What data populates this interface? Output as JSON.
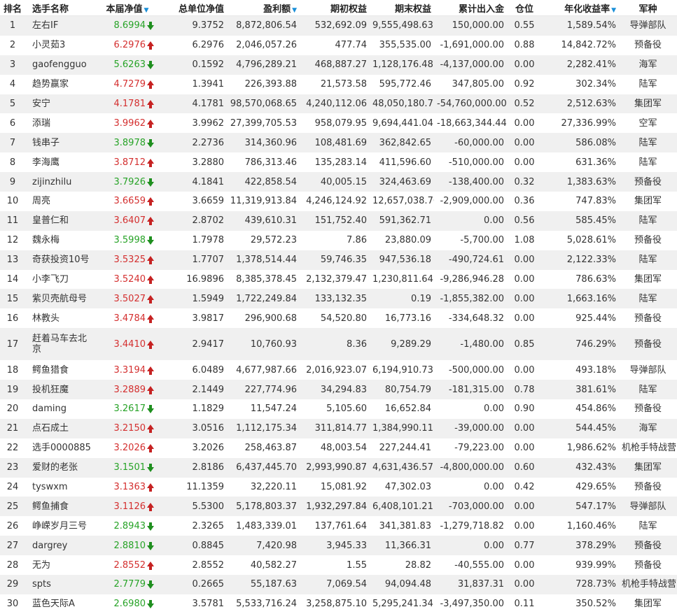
{
  "headers": {
    "rank": "排名",
    "name": "选手名称",
    "nav": "本届净值",
    "total_nav": "总单位净值",
    "profit": "盈利额",
    "start_equity": "期初权益",
    "end_equity": "期末权益",
    "cum_flow": "累计出入金",
    "position": "仓位",
    "annual_return": "年化收益率",
    "army": "军种"
  },
  "sort_icon": "triangle-down-icon",
  "colors": {
    "up": "#d42f2f",
    "down": "#27a327",
    "sort": "#1a8fd8",
    "row_alt": "#f0f0f0"
  },
  "rows": [
    {
      "rank": "1",
      "name": "左右IF",
      "nav": "8.6994",
      "dir": "down",
      "total_nav": "9.3752",
      "profit": "8,872,806.54",
      "start_equity": "532,692.09",
      "end_equity": "9,555,498.63",
      "cum_flow": "150,000.00",
      "position": "0.55",
      "annual_return": "1,589.54%",
      "army": "导弹部队"
    },
    {
      "rank": "2",
      "name": "小灵茹3",
      "nav": "6.2976",
      "dir": "up",
      "total_nav": "6.2976",
      "profit": "2,046,057.26",
      "start_equity": "477.74",
      "end_equity": "355,535.00",
      "cum_flow": "-1,691,000.00",
      "position": "0.88",
      "annual_return": "14,842.72%",
      "army": "预备役"
    },
    {
      "rank": "3",
      "name": "gaofengguo",
      "nav": "5.6263",
      "dir": "down",
      "total_nav": "0.1592",
      "profit": "4,796,289.21",
      "start_equity": "468,887.27",
      "end_equity": "1,128,176.48",
      "cum_flow": "-4,137,000.00",
      "position": "0.00",
      "annual_return": "2,282.41%",
      "army": "海军"
    },
    {
      "rank": "4",
      "name": "趋势赢家",
      "nav": "4.7279",
      "dir": "up",
      "total_nav": "1.3941",
      "profit": "226,393.88",
      "start_equity": "21,573.58",
      "end_equity": "595,772.46",
      "cum_flow": "347,805.00",
      "position": "0.92",
      "annual_return": "302.34%",
      "army": "陆军"
    },
    {
      "rank": "5",
      "name": "安宁",
      "nav": "4.1781",
      "dir": "up",
      "total_nav": "4.1781",
      "profit": "98,570,068.65",
      "start_equity": "4,240,112.06",
      "end_equity": "48,050,180.71",
      "cum_flow": "-54,760,000.00",
      "position": "0.52",
      "annual_return": "2,512.63%",
      "army": "集团军"
    },
    {
      "rank": "6",
      "name": "添瑞",
      "nav": "3.9962",
      "dir": "up",
      "total_nav": "3.9962",
      "profit": "27,399,705.53",
      "start_equity": "958,079.95",
      "end_equity": "9,694,441.04",
      "cum_flow": "-18,663,344.44",
      "position": "0.00",
      "annual_return": "27,336.99%",
      "army": "空军"
    },
    {
      "rank": "7",
      "name": "钱串子",
      "nav": "3.8978",
      "dir": "down",
      "total_nav": "2.2736",
      "profit": "314,360.96",
      "start_equity": "108,481.69",
      "end_equity": "362,842.65",
      "cum_flow": "-60,000.00",
      "position": "0.00",
      "annual_return": "586.08%",
      "army": "陆军"
    },
    {
      "rank": "8",
      "name": "李海鹰",
      "nav": "3.8712",
      "dir": "up",
      "total_nav": "3.2880",
      "profit": "786,313.46",
      "start_equity": "135,283.14",
      "end_equity": "411,596.60",
      "cum_flow": "-510,000.00",
      "position": "0.00",
      "annual_return": "631.36%",
      "army": "陆军"
    },
    {
      "rank": "9",
      "name": "zijinzhilu",
      "nav": "3.7926",
      "dir": "down",
      "total_nav": "4.1841",
      "profit": "422,858.54",
      "start_equity": "40,005.15",
      "end_equity": "324,463.69",
      "cum_flow": "-138,400.00",
      "position": "0.32",
      "annual_return": "1,383.63%",
      "army": "预备役"
    },
    {
      "rank": "10",
      "name": "周亮",
      "nav": "3.6659",
      "dir": "up",
      "total_nav": "3.6659",
      "profit": "11,319,913.84",
      "start_equity": "4,246,124.92",
      "end_equity": "12,657,038.76",
      "cum_flow": "-2,909,000.00",
      "position": "0.36",
      "annual_return": "747.83%",
      "army": "集团军"
    },
    {
      "rank": "11",
      "name": "皇普仁和",
      "nav": "3.6407",
      "dir": "up",
      "total_nav": "2.8702",
      "profit": "439,610.31",
      "start_equity": "151,752.40",
      "end_equity": "591,362.71",
      "cum_flow": "0.00",
      "position": "0.56",
      "annual_return": "585.45%",
      "army": "陆军"
    },
    {
      "rank": "12",
      "name": "魏永梅",
      "nav": "3.5998",
      "dir": "down",
      "total_nav": "1.7978",
      "profit": "29,572.23",
      "start_equity": "7.86",
      "end_equity": "23,880.09",
      "cum_flow": "-5,700.00",
      "position": "1.08",
      "annual_return": "5,028.61%",
      "army": "预备役"
    },
    {
      "rank": "13",
      "name": "奇获投资10号",
      "nav": "3.5325",
      "dir": "up",
      "total_nav": "1.7707",
      "profit": "1,378,514.44",
      "start_equity": "59,746.35",
      "end_equity": "947,536.18",
      "cum_flow": "-490,724.61",
      "position": "0.00",
      "annual_return": "2,122.33%",
      "army": "陆军"
    },
    {
      "rank": "14",
      "name": "小李飞刀",
      "nav": "3.5240",
      "dir": "up",
      "total_nav": "16.9896",
      "profit": "8,385,378.45",
      "start_equity": "2,132,379.47",
      "end_equity": "1,230,811.64",
      "cum_flow": "-9,286,946.28",
      "position": "0.00",
      "annual_return": "786.63%",
      "army": "集团军"
    },
    {
      "rank": "15",
      "name": "紫贝壳航母号",
      "nav": "3.5027",
      "dir": "up",
      "total_nav": "1.5949",
      "profit": "1,722,249.84",
      "start_equity": "133,132.35",
      "end_equity": "0.19",
      "cum_flow": "-1,855,382.00",
      "position": "0.00",
      "annual_return": "1,663.16%",
      "army": "陆军"
    },
    {
      "rank": "16",
      "name": "林教头",
      "nav": "3.4784",
      "dir": "up",
      "total_nav": "3.9817",
      "profit": "296,900.68",
      "start_equity": "54,520.80",
      "end_equity": "16,773.16",
      "cum_flow": "-334,648.32",
      "position": "0.00",
      "annual_return": "925.44%",
      "army": "预备役"
    },
    {
      "rank": "17",
      "name": "赶着马车去北京",
      "nav": "3.4410",
      "dir": "up",
      "total_nav": "2.9417",
      "profit": "10,760.93",
      "start_equity": "8.36",
      "end_equity": "9,289.29",
      "cum_flow": "-1,480.00",
      "position": "0.85",
      "annual_return": "746.29%",
      "army": "预备役",
      "tall": true
    },
    {
      "rank": "18",
      "name": "鳄鱼猎食",
      "nav": "3.3194",
      "dir": "up",
      "total_nav": "6.0489",
      "profit": "4,677,987.66",
      "start_equity": "2,016,923.07",
      "end_equity": "6,194,910.73",
      "cum_flow": "-500,000.00",
      "position": "0.00",
      "annual_return": "493.18%",
      "army": "导弹部队"
    },
    {
      "rank": "19",
      "name": "投机狂魔",
      "nav": "3.2889",
      "dir": "up",
      "total_nav": "2.1449",
      "profit": "227,774.96",
      "start_equity": "34,294.83",
      "end_equity": "80,754.79",
      "cum_flow": "-181,315.00",
      "position": "0.78",
      "annual_return": "381.61%",
      "army": "陆军"
    },
    {
      "rank": "20",
      "name": "daming",
      "nav": "3.2617",
      "dir": "down",
      "total_nav": "1.1829",
      "profit": "11,547.24",
      "start_equity": "5,105.60",
      "end_equity": "16,652.84",
      "cum_flow": "0.00",
      "position": "0.90",
      "annual_return": "454.86%",
      "army": "预备役"
    },
    {
      "rank": "21",
      "name": "点石成土",
      "nav": "3.2150",
      "dir": "up",
      "total_nav": "3.0516",
      "profit": "1,112,175.34",
      "start_equity": "311,814.77",
      "end_equity": "1,384,990.11",
      "cum_flow": "-39,000.00",
      "position": "0.00",
      "annual_return": "544.45%",
      "army": "海军"
    },
    {
      "rank": "22",
      "name": "选手0000885",
      "nav": "3.2026",
      "dir": "up",
      "total_nav": "3.2026",
      "profit": "258,463.87",
      "start_equity": "48,003.54",
      "end_equity": "227,244.41",
      "cum_flow": "-79,223.00",
      "position": "0.00",
      "annual_return": "1,986.62%",
      "army": "机枪手特战营"
    },
    {
      "rank": "23",
      "name": "爱财的老张",
      "nav": "3.1501",
      "dir": "down",
      "total_nav": "2.8186",
      "profit": "6,437,445.70",
      "start_equity": "2,993,990.87",
      "end_equity": "4,631,436.57",
      "cum_flow": "-4,800,000.00",
      "position": "0.60",
      "annual_return": "432.43%",
      "army": "集团军"
    },
    {
      "rank": "24",
      "name": "tyswxm",
      "nav": "3.1363",
      "dir": "up",
      "total_nav": "11.1359",
      "profit": "32,220.11",
      "start_equity": "15,081.92",
      "end_equity": "47,302.03",
      "cum_flow": "0.00",
      "position": "0.42",
      "annual_return": "429.65%",
      "army": "预备役"
    },
    {
      "rank": "25",
      "name": "鳄鱼捕食",
      "nav": "3.1126",
      "dir": "up",
      "total_nav": "5.5300",
      "profit": "5,178,803.37",
      "start_equity": "1,932,297.84",
      "end_equity": "6,408,101.21",
      "cum_flow": "-703,000.00",
      "position": "0.00",
      "annual_return": "547.17%",
      "army": "导弹部队"
    },
    {
      "rank": "26",
      "name": "峥嵘岁月三号",
      "nav": "2.8943",
      "dir": "down",
      "total_nav": "2.3265",
      "profit": "1,483,339.01",
      "start_equity": "137,761.64",
      "end_equity": "341,381.83",
      "cum_flow": "-1,279,718.82",
      "position": "0.00",
      "annual_return": "1,160.46%",
      "army": "陆军"
    },
    {
      "rank": "27",
      "name": "dargrey",
      "nav": "2.8810",
      "dir": "down",
      "total_nav": "0.8845",
      "profit": "7,420.98",
      "start_equity": "3,945.33",
      "end_equity": "11,366.31",
      "cum_flow": "0.00",
      "position": "0.77",
      "annual_return": "378.29%",
      "army": "预备役"
    },
    {
      "rank": "28",
      "name": "无为",
      "nav": "2.8552",
      "dir": "up",
      "total_nav": "2.8552",
      "profit": "40,582.27",
      "start_equity": "1.55",
      "end_equity": "28.82",
      "cum_flow": "-40,555.00",
      "position": "0.00",
      "annual_return": "939.99%",
      "army": "预备役"
    },
    {
      "rank": "29",
      "name": "spts",
      "nav": "2.7779",
      "dir": "down",
      "total_nav": "0.2665",
      "profit": "55,187.63",
      "start_equity": "7,069.54",
      "end_equity": "94,094.48",
      "cum_flow": "31,837.31",
      "position": "0.00",
      "annual_return": "728.73%",
      "army": "机枪手特战营"
    },
    {
      "rank": "30",
      "name": "蓝色天际A",
      "nav": "2.6980",
      "dir": "down",
      "total_nav": "3.5781",
      "profit": "5,533,716.24",
      "start_equity": "3,258,875.10",
      "end_equity": "5,295,241.34",
      "cum_flow": "-3,497,350.00",
      "position": "0.11",
      "annual_return": "350.52%",
      "army": "集团军"
    }
  ]
}
